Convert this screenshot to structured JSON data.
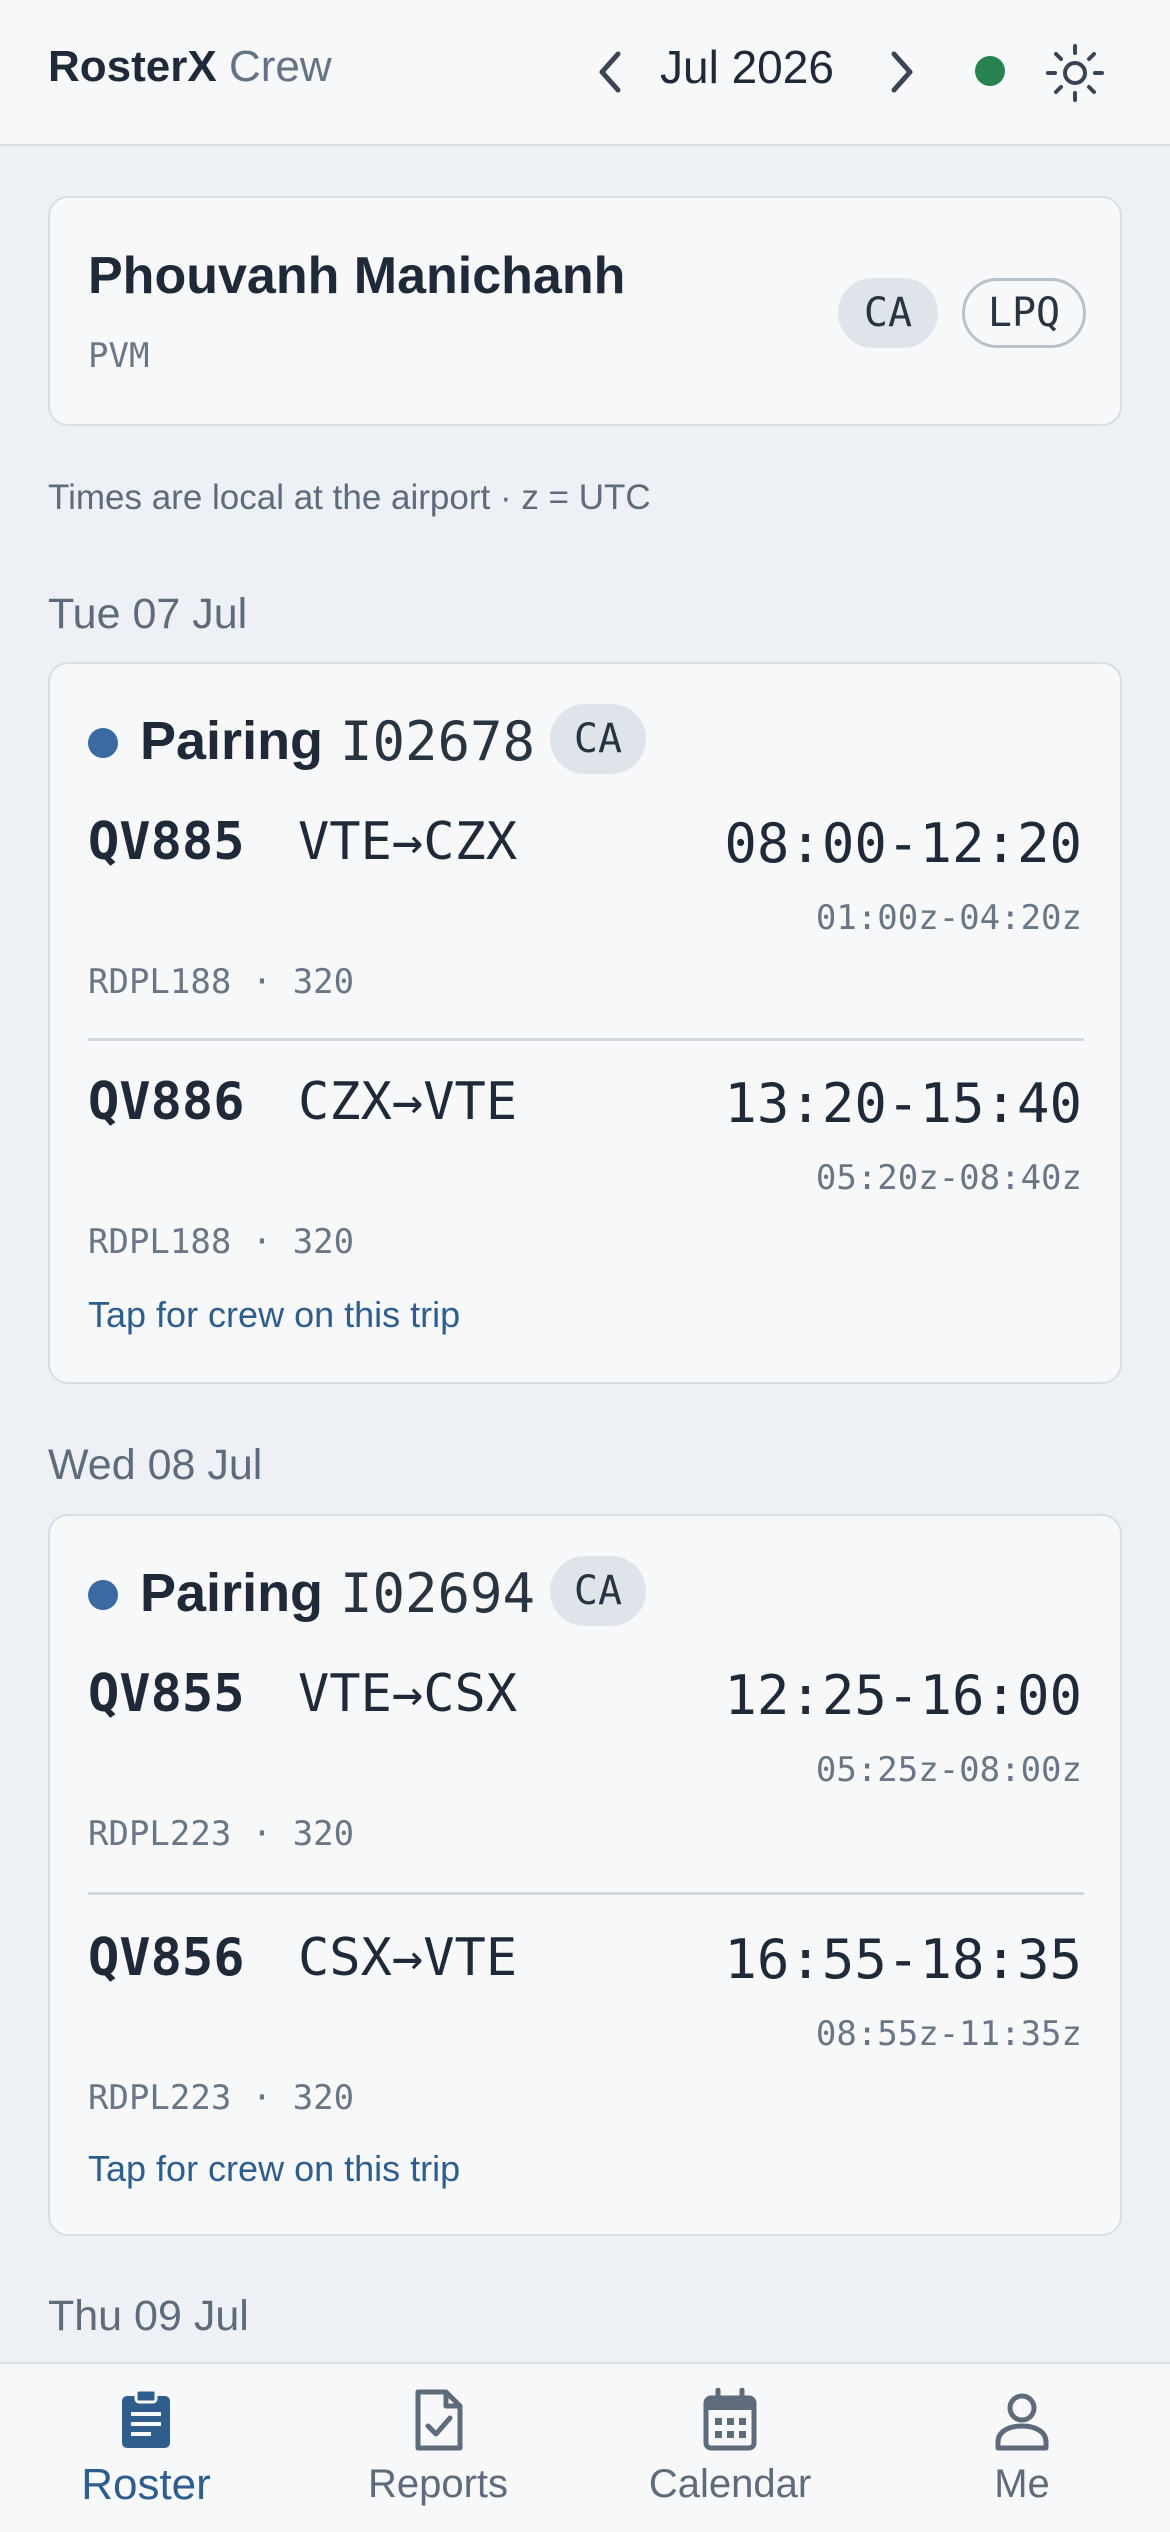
{
  "app": {
    "brand_bold": "RosterX",
    "brand_light": "Crew"
  },
  "header": {
    "month": "Jul 2026",
    "status_color": "#27824f"
  },
  "profile": {
    "name": "Phouvanh Manichanh",
    "code": "PVM",
    "rank": "CA",
    "base": "LPQ"
  },
  "note": "Times are local at the airport · z = UTC",
  "days": [
    {
      "heading": "Tue 07 Jul",
      "pairing_label": "Pairing",
      "pairing_id": "I02678",
      "rank": "CA",
      "flights": [
        {
          "number": "QV885",
          "route": "VTE→CZX",
          "local": "08:00-12:20",
          "utc": "01:00z-04:20z",
          "meta": "RDPL188 · 320"
        },
        {
          "number": "QV886",
          "route": "CZX→VTE",
          "local": "13:20-15:40",
          "utc": "05:20z-08:40z",
          "meta": "RDPL188 · 320"
        }
      ],
      "crew_link": "Tap for crew on this trip"
    },
    {
      "heading": "Wed 08 Jul",
      "pairing_label": "Pairing",
      "pairing_id": "I02694",
      "rank": "CA",
      "flights": [
        {
          "number": "QV855",
          "route": "VTE→CSX",
          "local": "12:25-16:00",
          "utc": "05:25z-08:00z",
          "meta": "RDPL223 · 320"
        },
        {
          "number": "QV856",
          "route": "CSX→VTE",
          "local": "16:55-18:35",
          "utc": "08:55z-11:35z",
          "meta": "RDPL223 · 320"
        }
      ],
      "crew_link": "Tap for crew on this trip"
    },
    {
      "heading": "Thu 09 Jul"
    }
  ],
  "nav": {
    "roster": {
      "label": "Roster",
      "icon": "roster-icon",
      "active": true
    },
    "reports": {
      "label": "Reports",
      "icon": "reports-icon"
    },
    "calendar": {
      "label": "Calendar",
      "icon": "calendar-icon"
    },
    "me": {
      "label": "Me",
      "icon": "person-icon"
    }
  },
  "colors": {
    "accent": "#2f5d8c",
    "pairing_dot": "#3b6aa3",
    "status_ok": "#27824f"
  }
}
